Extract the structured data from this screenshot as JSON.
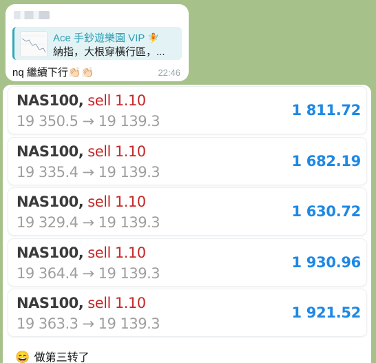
{
  "message": {
    "reply": {
      "title": "Ace 手鈔遊樂園 VIP",
      "title_emoji": "🧚",
      "snippet": "納指，大根穿橫行區，..."
    },
    "text": "nq 繼續下行👏🏻👏🏻",
    "time": "22:46"
  },
  "trades": [
    {
      "symbol": "NAS100",
      "side": "sell",
      "volume": "1.10",
      "open": "19 350.5",
      "close": "19 139.3",
      "profit": "1 811.72"
    },
    {
      "symbol": "NAS100",
      "side": "sell",
      "volume": "1.10",
      "open": "19 335.4",
      "close": "19 139.3",
      "profit": "1 682.19"
    },
    {
      "symbol": "NAS100",
      "side": "sell",
      "volume": "1.10",
      "open": "19 329.4",
      "close": "19 139.3",
      "profit": "1 630.72"
    },
    {
      "symbol": "NAS100",
      "side": "sell",
      "volume": "1.10",
      "open": "19 364.4",
      "close": "19 139.3",
      "profit": "1 930.96"
    },
    {
      "symbol": "NAS100",
      "side": "sell",
      "volume": "1.10",
      "open": "19 363.3",
      "close": "19 139.3",
      "profit": "1 921.52"
    }
  ],
  "trade_separator": ",",
  "trade_arrow": "→",
  "footer": {
    "emoji": "😄",
    "text": "做第三转了"
  },
  "colors": {
    "background": "#a7c18b",
    "sell": "#c62828",
    "profit": "#1e88e5",
    "reply_accent": "#2ea6b8"
  }
}
